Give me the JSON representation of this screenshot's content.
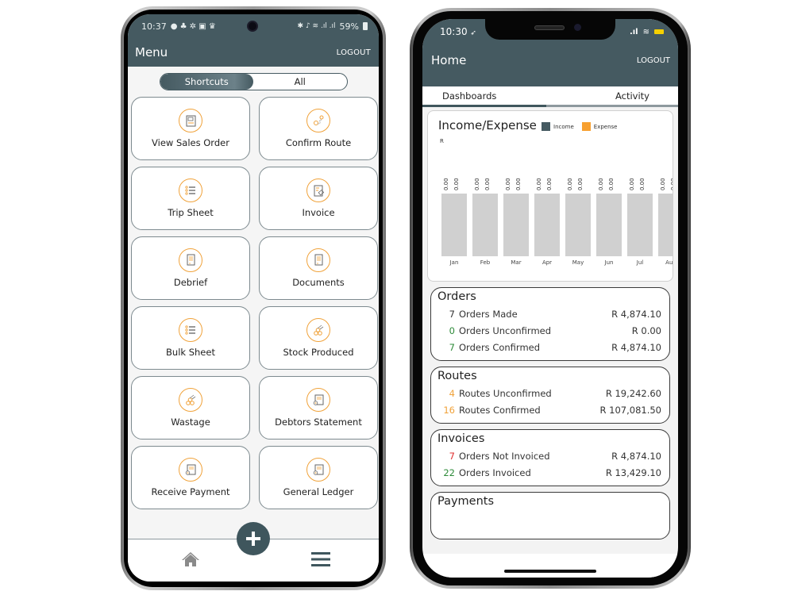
{
  "android": {
    "status_bar": {
      "time": "10:37",
      "battery": "59%"
    },
    "header": {
      "title": "Menu",
      "logout_label": "LOGOUT"
    },
    "segmented": {
      "options": [
        "Shortcuts",
        "All"
      ],
      "selected": "Shortcuts"
    },
    "tiles": [
      {
        "label": "View Sales Order",
        "icon": "sales-order-icon"
      },
      {
        "label": "Confirm Route",
        "icon": "route-icon"
      },
      {
        "label": "Trip Sheet",
        "icon": "list-icon"
      },
      {
        "label": "Invoice",
        "icon": "invoice-icon"
      },
      {
        "label": "Debrief",
        "icon": "document-icon"
      },
      {
        "label": "Documents",
        "icon": "document-icon"
      },
      {
        "label": "Bulk Sheet",
        "icon": "list-icon"
      },
      {
        "label": "Stock Produced",
        "icon": "pipes-icon"
      },
      {
        "label": "Wastage",
        "icon": "pipes-icon"
      },
      {
        "label": "Debtors Statement",
        "icon": "statement-icon"
      },
      {
        "label": "Receive Payment",
        "icon": "statement-icon"
      },
      {
        "label": "General Ledger",
        "icon": "statement-icon"
      }
    ],
    "bottom_nav": {
      "home": "home-icon",
      "add": "plus-icon",
      "menu": "hamburger-icon"
    }
  },
  "ios": {
    "status_bar": {
      "time": "10:30"
    },
    "header": {
      "title": "Home",
      "logout_label": "LOGOUT"
    },
    "tabs": [
      {
        "label": "Dashboards",
        "active": true
      },
      {
        "label": "Activity",
        "active": false
      }
    ],
    "colors": {
      "income": "#455a61",
      "expense": "#f7a030",
      "header": "#455a61",
      "green": "#2e8b3a",
      "orange": "#f0a23a",
      "red": "#e03030"
    },
    "orders": {
      "title": "Orders",
      "rows": [
        {
          "count": "7",
          "label": "Orders Made",
          "amount": "R 4,874.10",
          "color": "dark"
        },
        {
          "count": "0",
          "label": "Orders Unconfirmed",
          "amount": "R 0.00",
          "color": "green"
        },
        {
          "count": "7",
          "label": "Orders Confirmed",
          "amount": "R 4,874.10",
          "color": "green"
        }
      ]
    },
    "routes": {
      "title": "Routes",
      "rows": [
        {
          "count": "4",
          "label": "Routes Unconfirmed",
          "amount": "R 19,242.60",
          "color": "orange"
        },
        {
          "count": "16",
          "label": "Routes Confirmed",
          "amount": "R 107,081.50",
          "color": "orange"
        }
      ]
    },
    "invoices": {
      "title": "Invoices",
      "rows": [
        {
          "count": "7",
          "label": "Orders Not Invoiced",
          "amount": "R 4,874.10",
          "color": "red"
        },
        {
          "count": "22",
          "label": "Orders Invoiced",
          "amount": "R 13,429.10",
          "color": "green"
        }
      ]
    },
    "payments": {
      "title": "Payments"
    }
  },
  "chart_data": {
    "type": "bar",
    "title": "Income/Expense",
    "ylabel": "R",
    "xlabel": "",
    "categories": [
      "Jan",
      "Feb",
      "Mar",
      "Apr",
      "May",
      "Jun",
      "Jul",
      "Aug"
    ],
    "series": [
      {
        "name": "Income",
        "color": "#455a61",
        "values": [
          0,
          0,
          0,
          0,
          0,
          0,
          0,
          0
        ]
      },
      {
        "name": "Expense",
        "color": "#f7a030",
        "values": [
          0,
          0,
          0,
          0,
          0,
          0,
          0,
          0
        ]
      }
    ],
    "value_labels": [
      "0.00",
      "0.00"
    ],
    "legend": [
      "Income",
      "Expense"
    ],
    "legend_position": "top",
    "placeholder_bar_color": "#d0d0d0"
  }
}
